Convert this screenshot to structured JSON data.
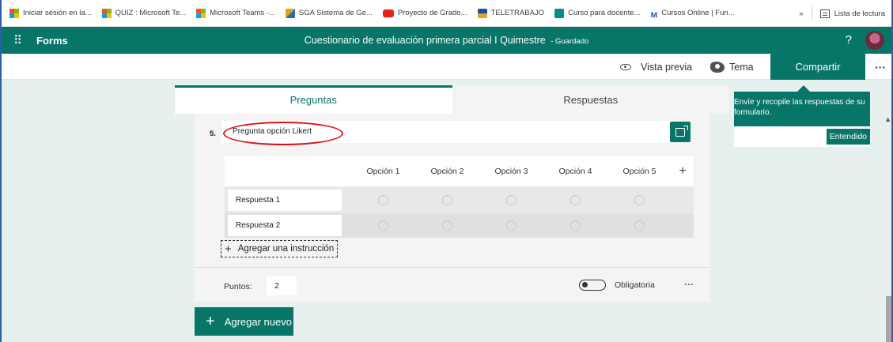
{
  "bookmarks": [
    {
      "label": "Iniciar sesión en la...",
      "icon": "microsoft-icon"
    },
    {
      "label": "QUIZ : Microsoft Te...",
      "icon": "microsoft-icon"
    },
    {
      "label": "Microsoft Teams -...",
      "icon": "microsoft-icon"
    },
    {
      "label": "SGA Sistema de Ge...",
      "icon": "sga-icon"
    },
    {
      "label": "Proyecto de Grado...",
      "icon": "youtube-icon"
    },
    {
      "label": "TELETRABAJO",
      "icon": "teletrabajo-icon"
    },
    {
      "label": "Curso para docente...",
      "icon": "curso-icon"
    },
    {
      "label": "Cursos Online | Fun...",
      "icon": "online-icon"
    }
  ],
  "bookmarks_more": "»",
  "reading_list": "Lista de lectura",
  "appbar": {
    "app_name": "Forms",
    "title": "Cuestionario de evaluación primera parcial I Quimestre",
    "saved": "- Guardado",
    "help": "?"
  },
  "cmdbar": {
    "preview": "Vista previa",
    "theme": "Tema",
    "share": "Compartir",
    "more": "···"
  },
  "tabs": {
    "questions": "Preguntas",
    "responses": "Respuestas"
  },
  "question": {
    "number": "5.",
    "title": "Pregunta opción Likert",
    "options": [
      "Opción 1",
      "Opción 2",
      "Opción 3",
      "Opción 4",
      "Opción 5"
    ],
    "add_option": "+",
    "rows": [
      "Respuesta 1",
      "Respuesta 2"
    ],
    "add_statement": "Agregar una instrucción",
    "points_label": "Puntos:",
    "points_value": "2",
    "required_label": "Obligatoria",
    "required": false,
    "more": "···"
  },
  "add_new": "Agregar nuevo",
  "tooltip": {
    "message": "Envíe y recopile las respuestas de su formulario.",
    "ok": "Entendido"
  },
  "colors": {
    "accent": "#077568",
    "highlight_ellipse": "#d9131b"
  }
}
